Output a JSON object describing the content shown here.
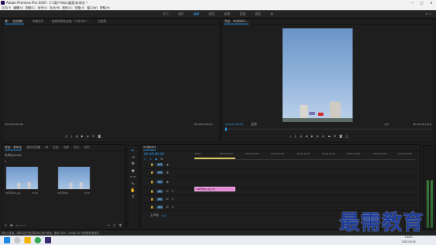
{
  "titlebar": {
    "title": "Adobe Premiere Pro 2020 - C:\\用户\\Abc\\桌面\\未命名 *",
    "min": "—",
    "max": "□",
    "close": "✕"
  },
  "menu": [
    "文件(F)",
    "编辑(E)",
    "剪辑(C)",
    "序列(S)",
    "标记(M)",
    "图形(G)",
    "视图(V)",
    "窗口(W)",
    "帮助(H)"
  ],
  "workspaces": {
    "items": [
      "学习",
      "组件",
      "编辑",
      "颜色",
      "效果",
      "音频",
      "图形",
      "库"
    ],
    "active_index": 2
  },
  "source_panel": {
    "tabs": [
      "源：（无剪辑）",
      "效果控件",
      "音频剪辑混合器：00序列01...",
      "元数据"
    ],
    "tc_left": "00:00:00:00",
    "tc_right": "00:00:00:00"
  },
  "program_panel": {
    "tab": "节目：00序列01...",
    "tc_left": "00:00:00:00",
    "fit": "适合",
    "quality": "1/2",
    "tc_right": "00:00:02:24"
  },
  "project_panel": {
    "tabs": [
      "项目：未命名",
      "媒体浏览器",
      "库",
      "信息",
      "效果",
      "标记",
      "历史"
    ],
    "filename": "未命名.prproj",
    "items": [
      {
        "label": "00序列01.jpg",
        "dur": "5:00"
      },
      {
        "label": "00序列01",
        "dur": "5:00"
      }
    ]
  },
  "timeline": {
    "title": "00序列01",
    "tc": "00:00:00:00",
    "clip_label": "00序列01.jpg [V]",
    "ruler": [
      "00:00",
      "00:00:05:00",
      "00:00:10:00",
      "00:00:15:00",
      "00:00:20:00",
      "00:00:25:00",
      "00:00:30:00",
      "00:00:35:00",
      "00:00:40:00"
    ],
    "tracks": [
      "V3",
      "V2",
      "V1",
      "A1",
      "A2",
      "A3"
    ],
    "master": "主声道",
    "master_val": "0.0"
  },
  "tools": [
    "▸",
    "⇥",
    "✥",
    "◆",
    "⟷",
    "✎",
    "✋",
    "T"
  ],
  "status": "单击以选择，或单击空白处并拖动以进行框选。使用 Shift、Alt 和 Ctrl 可获得其他选项。",
  "watermark": "最需教育",
  "clock": {
    "time": "14:21",
    "date": "2021/11/5"
  }
}
